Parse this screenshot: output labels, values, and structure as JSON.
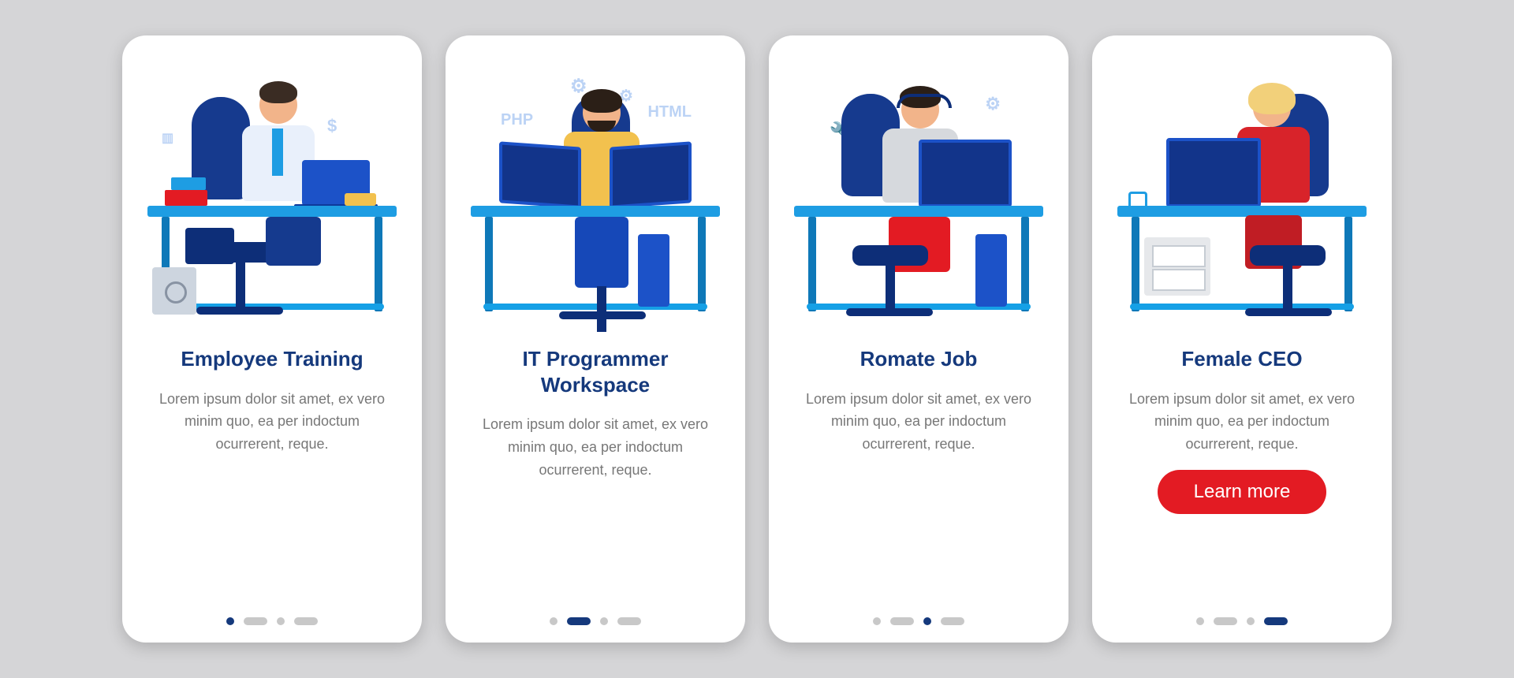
{
  "colors": {
    "brand": "#15397c",
    "cta": "#e31b23",
    "desk": "#1e9de3"
  },
  "cards": [
    {
      "title": "Employee Training",
      "body": "Lorem ipsum dolor sit amet, ex vero minim quo, ea per indoctum ocurrerent, reque.",
      "activeIndex": 0
    },
    {
      "title": "IT Programmer Workspace",
      "body": "Lorem ipsum dolor sit amet, ex vero minim quo, ea per indoctum ocurrerent, reque.",
      "activeIndex": 1
    },
    {
      "title": "Romate Job",
      "body": "Lorem ipsum dolor sit amet, ex vero minim quo, ea per indoctum ocurrerent, reque.",
      "activeIndex": 2
    },
    {
      "title": "Female CEO",
      "body": "Lorem ipsum dolor sit amet, ex vero minim quo, ea per indoctum ocurrerent, reque.",
      "cta": "Learn more",
      "activeIndex": 3
    }
  ]
}
